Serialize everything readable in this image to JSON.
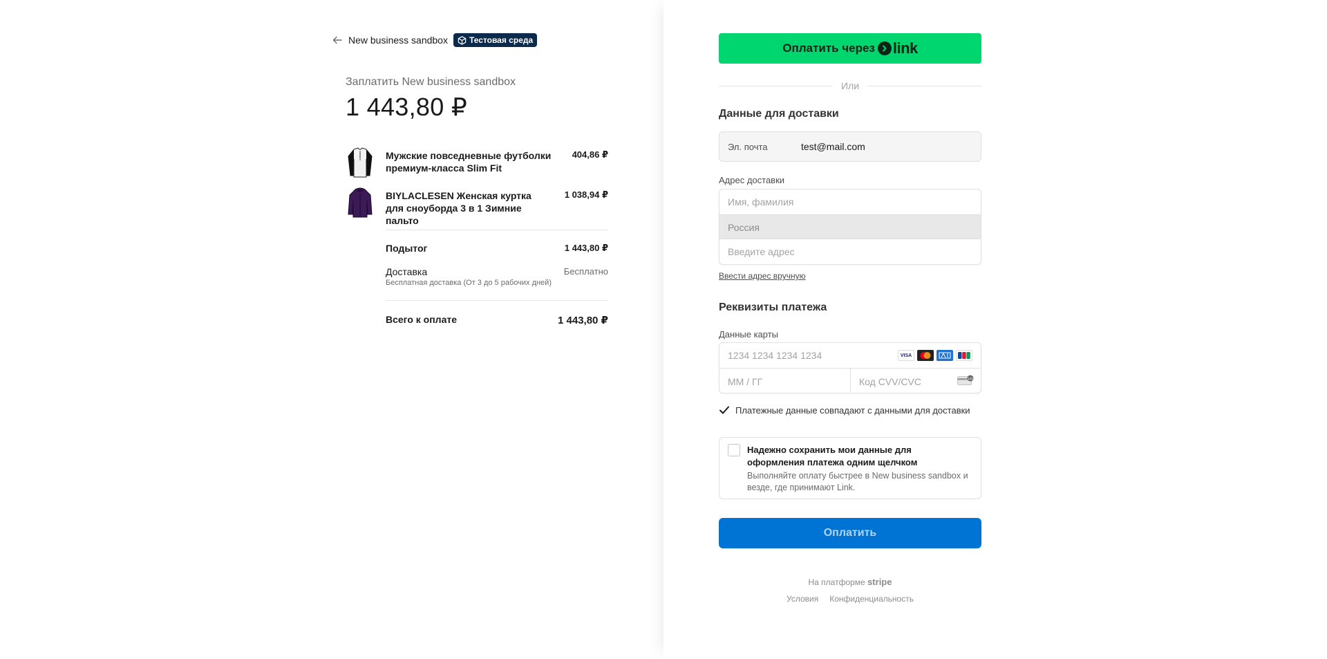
{
  "merchant": {
    "name": "New business sandbox",
    "test_badge": "Тестовая среда",
    "pay_to": "Заплатить New business sandbox",
    "total": "1 443,80 ₽"
  },
  "items": [
    {
      "name": "Мужские повседневные футболки премиум-класса Slim Fit",
      "price": "404,86 ₽"
    },
    {
      "name": "BIYLACLESEN Женская куртка для сноуборда 3 в 1 Зимние пальто",
      "price": "1 038,94 ₽"
    }
  ],
  "summary": {
    "subtotal_label": "Подытог",
    "subtotal_value": "1 443,80 ₽",
    "shipping_label": "Доставка",
    "shipping_value": "Бесплатно",
    "shipping_note": "Бесплатная доставка (От 3 до 5 рабочих дней)",
    "total_label": "Всего к оплате",
    "total_value": "1 443,80 ₽"
  },
  "link_button": {
    "label": "Оплатить через",
    "logo": "link"
  },
  "or_text": "Или",
  "shipping": {
    "title": "Данные для доставки",
    "email_label": "Эл. почта",
    "email_value": "test@mail.com",
    "address_label": "Адрес доставки",
    "name_placeholder": "Имя, фамилия",
    "country": "Россия",
    "address_placeholder": "Введите адрес",
    "manual_link": "Ввести адрес вручную"
  },
  "payment": {
    "title": "Реквизиты платежа",
    "card_label": "Данные карты",
    "card_placeholder": "1234 1234 1234 1234",
    "exp_placeholder": "ММ / ГГ",
    "cvc_placeholder": "Код CVV/CVC",
    "brands": [
      "VISA",
      "MC",
      "AMEX",
      "JCB"
    ],
    "same_as_shipping": "Платежные данные совпадают с данными для доставки",
    "save_title": "Надежно сохранить мои данные для оформления платежа одним щелчком",
    "save_desc": "Выполняйте оплату быстрее в New business sandbox и везде, где принимают Link.",
    "pay_button": "Оплатить"
  },
  "footer": {
    "powered_prefix": "На платформе",
    "powered_brand": "stripe",
    "terms": "Условия",
    "privacy": "Конфиденциальность"
  },
  "colors": {
    "link_green": "#00d66f",
    "pay_blue": "#0074d4",
    "badge_navy": "#0c2a4b"
  }
}
